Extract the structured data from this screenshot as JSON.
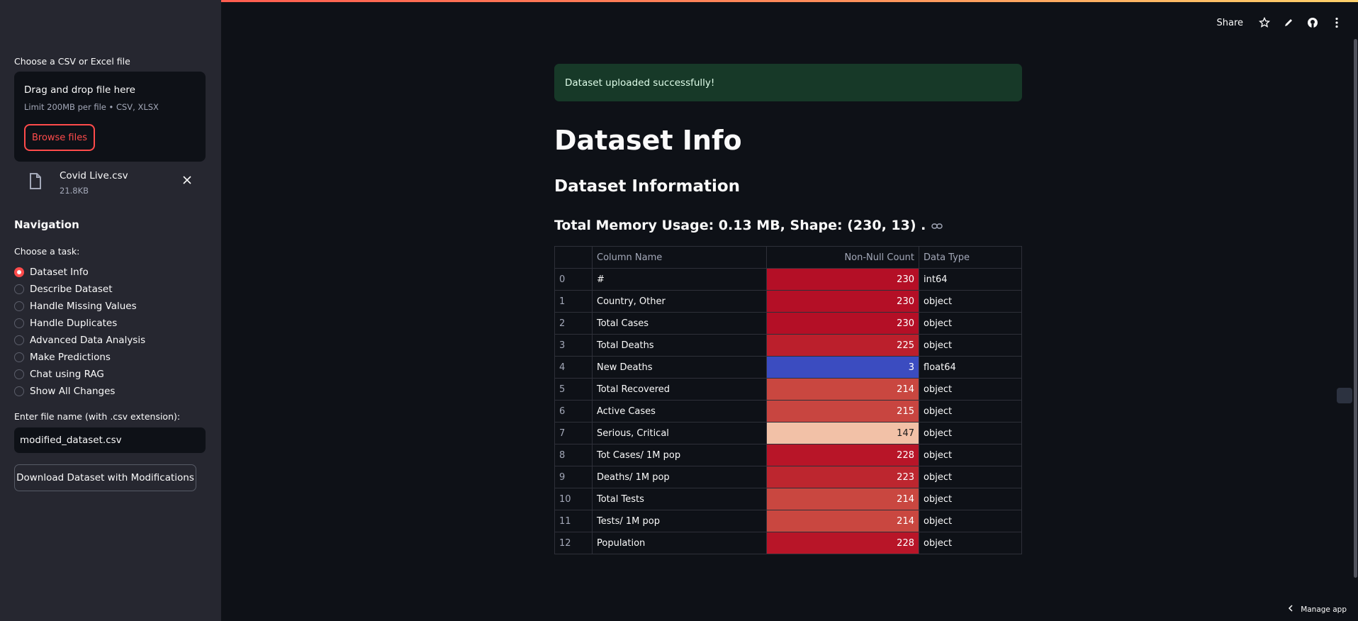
{
  "sidebar": {
    "upload_label": "Choose a CSV or Excel file",
    "dropzone_title": "Drag and drop file here",
    "dropzone_limit": "Limit 200MB per file • CSV, XLSX",
    "browse_label": "Browse files",
    "file": {
      "name": "Covid Live.csv",
      "size": "21.8KB"
    },
    "nav_title": "Navigation",
    "task_label": "Choose a task:",
    "tasks": [
      "Dataset Info",
      "Describe Dataset",
      "Handle Missing Values",
      "Handle Duplicates",
      "Advanced Data Analysis",
      "Make Predictions",
      "Chat using RAG",
      "Show All Changes"
    ],
    "selected_task": "Dataset Info",
    "filename_label": "Enter file name (with .csv extension):",
    "filename_value": "modified_dataset.csv",
    "download_label": "Download Dataset with Modifications"
  },
  "toolbar": {
    "share_label": "Share"
  },
  "main": {
    "alert": "Dataset uploaded successfully!",
    "title": "Dataset Info",
    "subtitle": "Dataset Information",
    "memory_heading": "Total Memory Usage: 0.13 MB, Shape: (230, 13) .",
    "table": {
      "headers": [
        "",
        "Column Name",
        "Non-Null Count",
        "Data Type"
      ],
      "rows": [
        {
          "idx": "0",
          "col": "#",
          "count": "230",
          "dtype": "int64",
          "bg": "#b40f26",
          "fg": "#ffffff"
        },
        {
          "idx": "1",
          "col": "Country, Other",
          "count": "230",
          "dtype": "object",
          "bg": "#b40f26",
          "fg": "#ffffff"
        },
        {
          "idx": "2",
          "col": "Total Cases",
          "count": "230",
          "dtype": "object",
          "bg": "#b40f26",
          "fg": "#ffffff"
        },
        {
          "idx": "3",
          "col": "Total Deaths",
          "count": "225",
          "dtype": "object",
          "bg": "#bb1f2c",
          "fg": "#ffffff"
        },
        {
          "idx": "4",
          "col": "New Deaths",
          "count": "3",
          "dtype": "float64",
          "bg": "#3b4cc0",
          "fg": "#ffffff"
        },
        {
          "idx": "5",
          "col": "Total Recovered",
          "count": "214",
          "dtype": "object",
          "bg": "#c94740",
          "fg": "#ffffff"
        },
        {
          "idx": "6",
          "col": "Active Cases",
          "count": "215",
          "dtype": "object",
          "bg": "#c84540",
          "fg": "#ffffff"
        },
        {
          "idx": "7",
          "col": "Serious, Critical",
          "count": "147",
          "dtype": "object",
          "bg": "#f2c1a7",
          "fg": "#1a1a1a"
        },
        {
          "idx": "8",
          "col": "Tot Cases/ 1M pop",
          "count": "228",
          "dtype": "object",
          "bg": "#b81528",
          "fg": "#ffffff"
        },
        {
          "idx": "9",
          "col": "Deaths/ 1M pop",
          "count": "223",
          "dtype": "object",
          "bg": "#bd262f",
          "fg": "#ffffff"
        },
        {
          "idx": "10",
          "col": "Total Tests",
          "count": "214",
          "dtype": "object",
          "bg": "#c94740",
          "fg": "#ffffff"
        },
        {
          "idx": "11",
          "col": "Tests/ 1M pop",
          "count": "214",
          "dtype": "object",
          "bg": "#c94740",
          "fg": "#ffffff"
        },
        {
          "idx": "12",
          "col": "Population",
          "count": "228",
          "dtype": "object",
          "bg": "#b81528",
          "fg": "#ffffff"
        }
      ]
    }
  },
  "footer": {
    "manage_label": "Manage app"
  },
  "colors": {
    "accent": "#ff4b4b",
    "success_bg": "#173928"
  }
}
